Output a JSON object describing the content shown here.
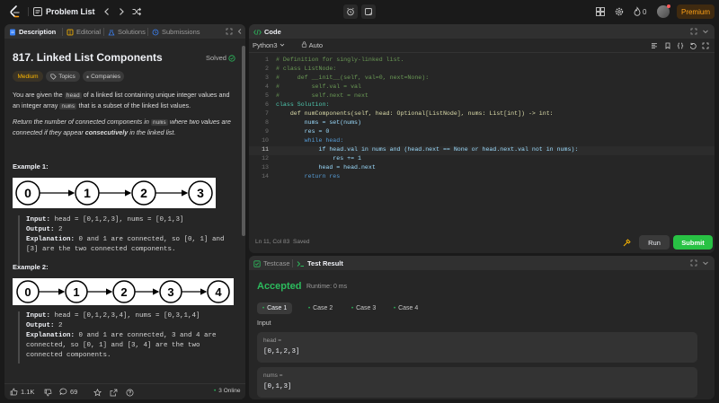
{
  "navbar": {
    "title": "Problem List",
    "fire_count": "0",
    "premium_label": "Premium"
  },
  "description": {
    "tabs": [
      "Description",
      "Editorial",
      "Solutions",
      "Submissions"
    ],
    "problem_title": "817. Linked List Components",
    "solved_label": "Solved",
    "difficulty": "Medium",
    "chips": [
      "Topics",
      "Companies"
    ],
    "para1_parts": [
      "You are given the ",
      "head",
      " of a linked list containing unique integer values and an integer array ",
      "nums",
      " that is a subset of the linked list values."
    ],
    "para2_parts": [
      "Return the number of connected components in ",
      "nums",
      " where two values are connected if they appear ",
      "consecutively",
      " in the linked list."
    ],
    "example1": {
      "title": "Example 1:",
      "nodes": [
        "0",
        "1",
        "2",
        "3"
      ],
      "input_label": "Input:",
      "input": "head = [0,1,2,3], nums = [0,1,3]",
      "output_label": "Output:",
      "output": "2",
      "explanation_label": "Explanation:",
      "explanation_l1": "0 and 1 are connected, so [0, 1] and",
      "explanation_l2": "[3] are the two connected components."
    },
    "example2": {
      "title": "Example 2:",
      "nodes": [
        "0",
        "1",
        "2",
        "3",
        "4"
      ],
      "input_label": "Input:",
      "input": "head = [0,1,2,3,4], nums = [0,3,1,4]",
      "output_label": "Output:",
      "output": "2",
      "explanation_label": "Explanation:",
      "explanation_l1": "0 and 1 are connected, 3 and 4 are",
      "explanation_l2": "connected, so [0, 1] and [3, 4] are the two",
      "explanation_l3": "connected components."
    },
    "footer": {
      "likes": "1.1K",
      "comments": "69",
      "online": "3 Online"
    }
  },
  "code": {
    "tab": "Code",
    "language": "Python3",
    "auto_label": "Auto",
    "lines": [
      {
        "n": "1",
        "t": "# Definition for singly-linked list."
      },
      {
        "n": "2",
        "t": "# class ListNode:"
      },
      {
        "n": "3",
        "t": "#     def __init__(self, val=0, next=None):"
      },
      {
        "n": "4",
        "t": "#         self.val = val"
      },
      {
        "n": "5",
        "t": "#         self.next = next"
      },
      {
        "n": "6",
        "t": "class Solution:"
      },
      {
        "n": "7",
        "t": "    def numComponents(self, head: Optional[ListNode], nums: List[int]) -> int:"
      },
      {
        "n": "8",
        "t": "        nums = set(nums)"
      },
      {
        "n": "9",
        "t": "        res = 0"
      },
      {
        "n": "10",
        "t": "        while head:"
      },
      {
        "n": "11",
        "t": "            if head.val in nums and (head.next == None or head.next.val not in nums):"
      },
      {
        "n": "12",
        "t": "                res += 1"
      },
      {
        "n": "13",
        "t": "            head = head.next"
      },
      {
        "n": "14",
        "t": "        return res"
      }
    ],
    "status_pos": "Ln 11, Col 83",
    "status_saved": "Saved",
    "run_label": "Run",
    "submit_label": "Submit"
  },
  "result": {
    "tabs": [
      "Testcase",
      "Test Result"
    ],
    "verdict": "Accepted",
    "runtime": "Runtime: 0 ms",
    "cases": [
      "Case 1",
      "Case 2",
      "Case 3",
      "Case 4"
    ],
    "input_label": "Input",
    "head_name": "head =",
    "head_value": "[0,1,2,3]",
    "nums_name": "nums =",
    "nums_value": "[0,1,3]"
  }
}
